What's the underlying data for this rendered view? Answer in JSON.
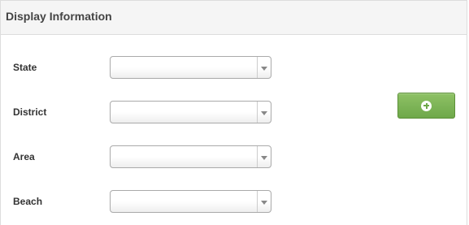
{
  "panel": {
    "title": "Display Information"
  },
  "form": {
    "fields": [
      {
        "label": "State",
        "value": ""
      },
      {
        "label": "District",
        "value": ""
      },
      {
        "label": "Area",
        "value": ""
      },
      {
        "label": "Beach",
        "value": ""
      }
    ],
    "add_button": {
      "icon": "plus-circle-icon"
    }
  },
  "colors": {
    "header_background": "#f5f5f5",
    "add_button_green": "#6ea84a"
  }
}
